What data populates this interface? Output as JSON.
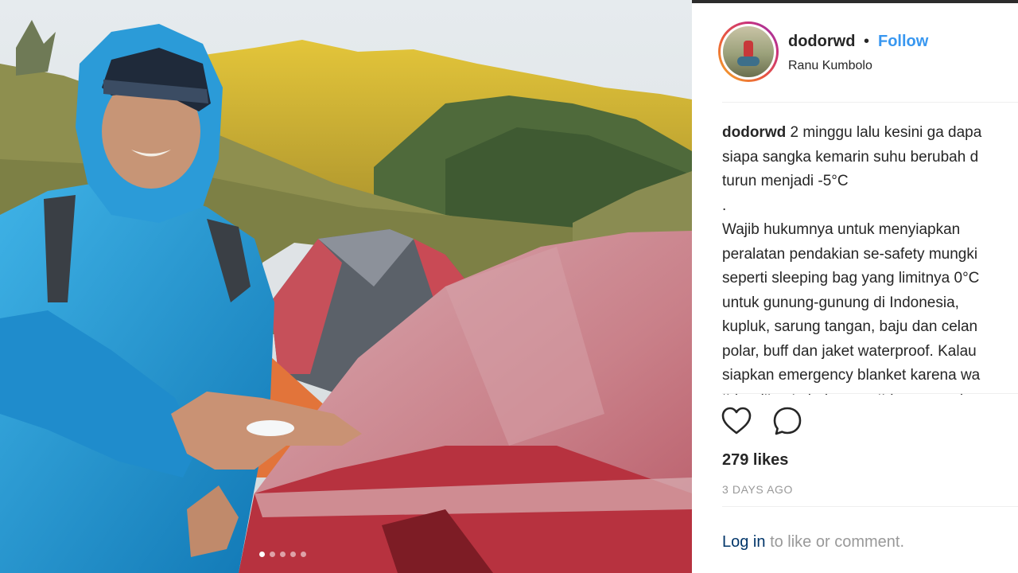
{
  "post": {
    "username": "dodorwd",
    "separator": "•",
    "follow_label": "Follow",
    "location": "Ranu Kumbolo",
    "caption_lines": [
      "2 minggu lalu kesini ga dapa",
      "siapa sangka kemarin suhu berubah d",
      "turun menjadi -5°C",
      ".",
      "Wajib hukumnya untuk menyiapkan",
      "peralatan pendakian se-safety mungki",
      "seperti sleeping bag yang limitnya 0°C",
      "untuk gunung-gunung di Indonesia,",
      "kupluk, sarung tangan, baju dan celan",
      "polar, buff dan jaket waterproof. Kalau",
      "siapkan emergency blanket karena wa",
      "tidur dijamin bukannya tidur nyenyak"
    ],
    "likes": "279 likes",
    "timestamp": "3 DAYS AGO",
    "login_link": "Log in",
    "login_rest": "to like or comment."
  },
  "carousel": {
    "count": 5,
    "active_index": 0
  },
  "icons": {
    "like": "heart-icon",
    "comment": "comment-icon"
  },
  "colors": {
    "follow": "#3897f0",
    "muted": "#999999",
    "text": "#262626",
    "link": "#003569"
  }
}
